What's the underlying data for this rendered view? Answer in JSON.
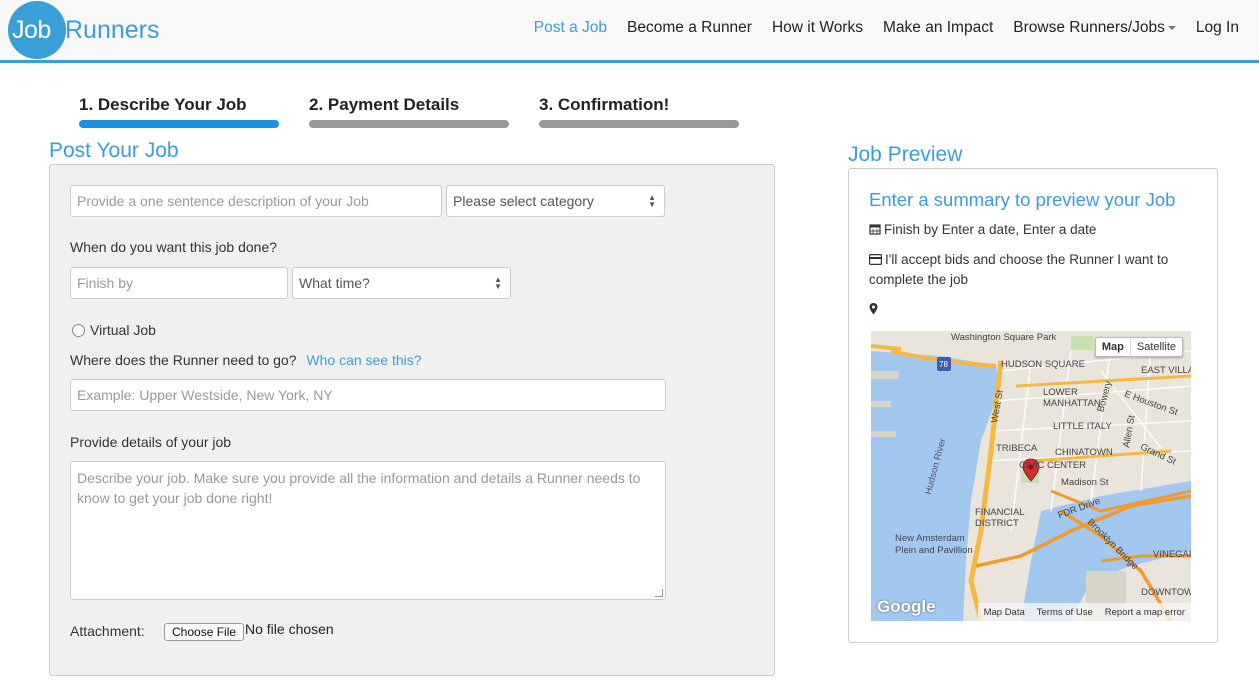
{
  "header": {
    "logo_part1": "Job",
    "logo_part2": "Runners",
    "nav": [
      {
        "label": "Post a Job"
      },
      {
        "label": "Become a Runner"
      },
      {
        "label": "How it Works"
      },
      {
        "label": "Make an Impact"
      },
      {
        "label": "Browse Runners/Jobs"
      },
      {
        "label": "Log In"
      }
    ]
  },
  "steps": [
    {
      "label": "1. Describe Your Job"
    },
    {
      "label": "2. Payment Details"
    },
    {
      "label": "3. Confirmation!"
    }
  ],
  "form": {
    "heading": "Post Your Job",
    "description_placeholder": "Provide a one sentence description of your Job",
    "category_value": "Please select category",
    "when_label": "When do you want this job done?",
    "finish_placeholder": "Finish by",
    "time_value": "What time?",
    "virtual_label": "Virtual Job",
    "where_label": "Where does the Runner need to go?",
    "who_link": "Who can see this?",
    "location_placeholder": "Example: Upper Westside, New York, NY",
    "details_label": "Provide details of your job",
    "details_placeholder": "Describe your job. Make sure you provide all the information and details a Runner needs to know to get your job done right!",
    "attachment_label": "Attachment:",
    "choose_file": "Choose File",
    "no_file": "No file chosen"
  },
  "preview": {
    "heading": "Job Preview",
    "summary": "Enter a summary to preview your Job",
    "finish": "Finish by Enter a date, Enter a date",
    "bids": "I'll accept bids and choose the Runner I want to complete the job",
    "map": {
      "toggle_map": "Map",
      "toggle_satellite": "Satellite",
      "footer": [
        "Map Data",
        "Terms of Use",
        "Report a map error"
      ],
      "google": "Google",
      "labels": [
        "Washington Square Park",
        "HUDSON SQUARE",
        "LOWER MANHATTAN",
        "EAST VILLA",
        "E Houston St",
        "Bowery",
        "Hudson River",
        "West St",
        "TRIBECA",
        "LITTLE ITALY",
        "Allen St",
        "CHINATOWN",
        "Grand St",
        "CIVIC CENTER",
        "Madison St",
        "FINANCIAL DISTRICT",
        "FDR Drive",
        "New Amsterdam Plein and Pavillion",
        "Brooklyn Bridge",
        "VINEGAR H",
        "DOWNTOWN",
        "78"
      ]
    },
    "colors": {
      "accent": "#3a9fd6",
      "water": "#a3c8f0",
      "road": "#f5b942",
      "land": "#e9e5dc"
    }
  }
}
